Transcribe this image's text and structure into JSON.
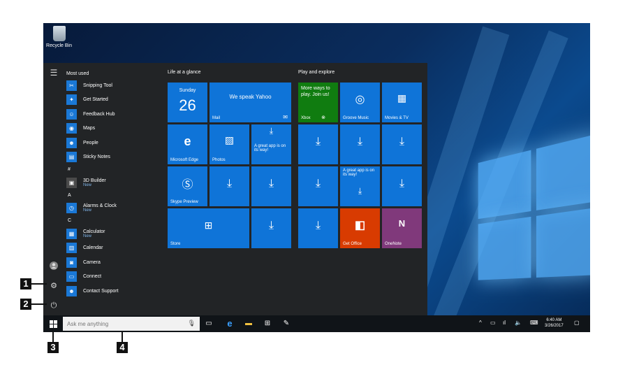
{
  "desktop": {
    "recycle_bin": "Recycle Bin"
  },
  "start_menu": {
    "most_used_header": "Most used",
    "most_used": [
      {
        "label": "Snipping Tool",
        "icon": "scissors-icon"
      },
      {
        "label": "Get Started",
        "icon": "lightbulb-icon"
      },
      {
        "label": "Feedback Hub",
        "icon": "feedback-icon"
      },
      {
        "label": "Maps",
        "icon": "maps-icon"
      },
      {
        "label": "People",
        "icon": "people-icon"
      },
      {
        "label": "Sticky Notes",
        "icon": "note-icon"
      }
    ],
    "sections": [
      {
        "letter": "#",
        "apps": [
          {
            "label": "3D Builder",
            "sub": "New"
          }
        ]
      },
      {
        "letter": "A",
        "apps": [
          {
            "label": "Alarms & Clock",
            "sub": "New"
          }
        ]
      },
      {
        "letter": "C",
        "apps": [
          {
            "label": "Calculator",
            "sub": "New"
          },
          {
            "label": "Calendar",
            "sub": ""
          },
          {
            "label": "Camera",
            "sub": ""
          },
          {
            "label": "Connect",
            "sub": ""
          },
          {
            "label": "Contact Support",
            "sub": ""
          }
        ]
      }
    ],
    "life_header": "Life at a glance",
    "play_header": "Play and explore",
    "calendar_day": "Sunday",
    "calendar_date": "26",
    "mail_text": "We speak Yahoo",
    "mail_label": "Mail",
    "edge_label": "Microsoft Edge",
    "photos_label": "Photos",
    "great_app": "A great app is on its way!",
    "skype_label": "Skype Preview",
    "store_label": "Store",
    "xbox_text": "More ways to play. Join us!",
    "xbox_label": "Xbox",
    "groove_label": "Groove Music",
    "movies_label": "Movies & TV",
    "office_label": "Get Office",
    "onenote_label": "OneNote"
  },
  "taskbar": {
    "search_placeholder": "Ask me anything",
    "time": "6:40 AM",
    "date": "3/26/2017"
  },
  "callouts": [
    "1",
    "2",
    "3",
    "4"
  ],
  "colors": {
    "tile_blue": "#0f74d8",
    "xbox_green": "#107c10",
    "office_orange": "#d83b01",
    "onenote_purple": "#80397b"
  }
}
